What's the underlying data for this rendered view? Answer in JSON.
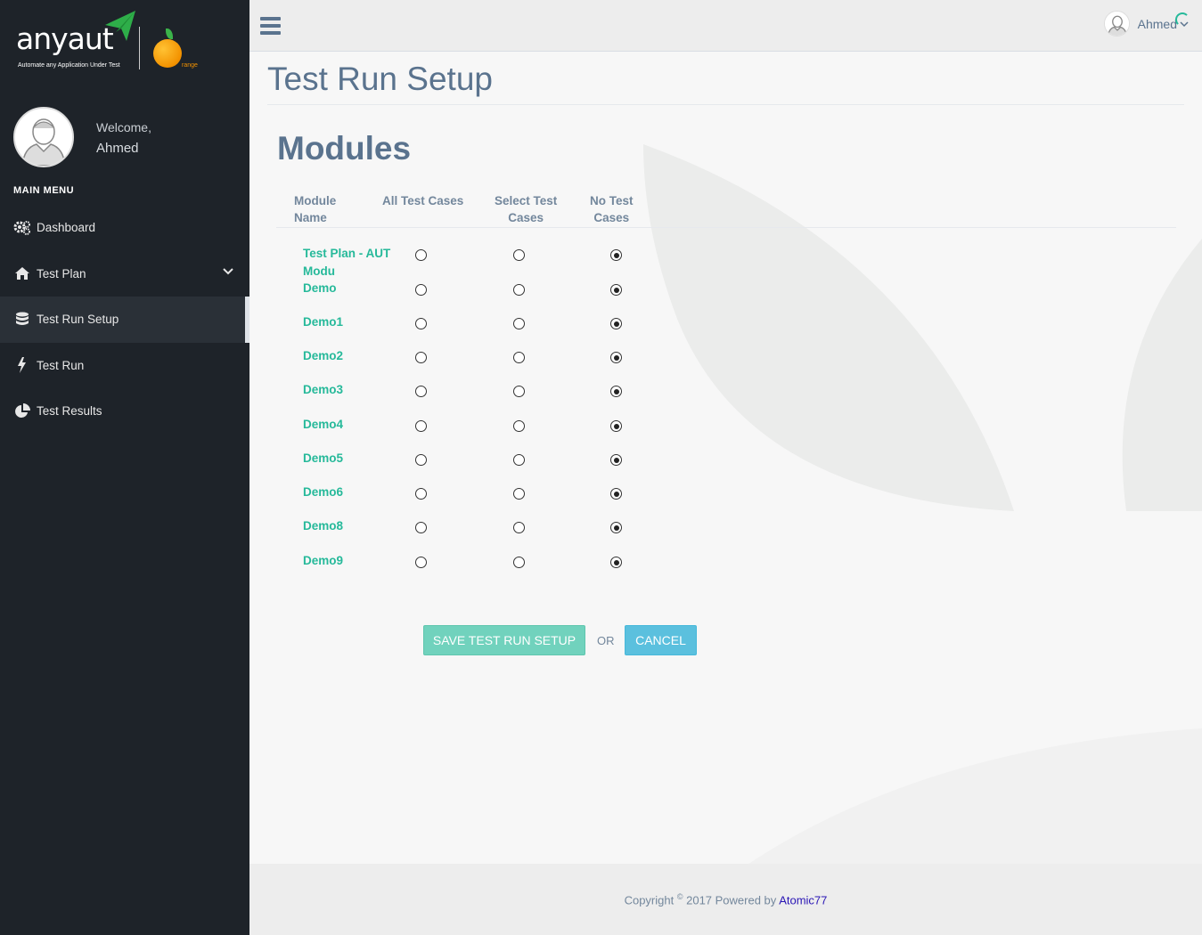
{
  "brand": {
    "logo_text": "anyaut",
    "tagline": "Automate any Application Under Test",
    "partner_suffix": "range"
  },
  "profile": {
    "welcome": "Welcome,",
    "name": "Ahmed"
  },
  "sidebar": {
    "menu_title": "MAIN MENU",
    "items": [
      {
        "label": "Dashboard",
        "icon": "gears-icon"
      },
      {
        "label": "Test Plan",
        "icon": "home-icon"
      },
      {
        "label": "Test Run Setup",
        "icon": "database-icon"
      },
      {
        "label": "Test Run",
        "icon": "bolt-icon"
      },
      {
        "label": "Test Results",
        "icon": "pie-chart-icon"
      }
    ]
  },
  "topbar": {
    "user_name": "Ahmed"
  },
  "page": {
    "title": "Test Run Setup",
    "section_title": "Modules"
  },
  "table": {
    "headers": {
      "module_name": [
        "Module",
        "Name"
      ],
      "all": [
        "All Test Cases"
      ],
      "select": [
        "Select Test",
        "Cases"
      ],
      "none": [
        "No Test",
        "Cases"
      ]
    },
    "rows": [
      {
        "name": "Test Plan - AUT Modu",
        "selected": "none"
      },
      {
        "name": "Demo",
        "selected": "none"
      },
      {
        "name": "Demo1",
        "selected": "none"
      },
      {
        "name": "Demo2",
        "selected": "none"
      },
      {
        "name": "Demo3",
        "selected": "none"
      },
      {
        "name": "Demo4",
        "selected": "none"
      },
      {
        "name": "Demo5",
        "selected": "none"
      },
      {
        "name": "Demo6",
        "selected": "none"
      },
      {
        "name": "Demo8",
        "selected": "none"
      },
      {
        "name": "Demo9",
        "selected": "none"
      }
    ]
  },
  "actions": {
    "save_label": "SAVE TEST RUN SETUP",
    "or_label": "OR",
    "cancel_label": "CANCEL"
  },
  "footer": {
    "copyright": "Copyright",
    "reg": "©",
    "text": "2017 Powered by",
    "link": "Atomic77"
  },
  "colors": {
    "sidebar_bg": "#1e2329",
    "accent_green": "#26b99a",
    "heading_blue": "#5a738e",
    "save_button": "#71d2bd",
    "cancel_button": "#5bc0de"
  }
}
